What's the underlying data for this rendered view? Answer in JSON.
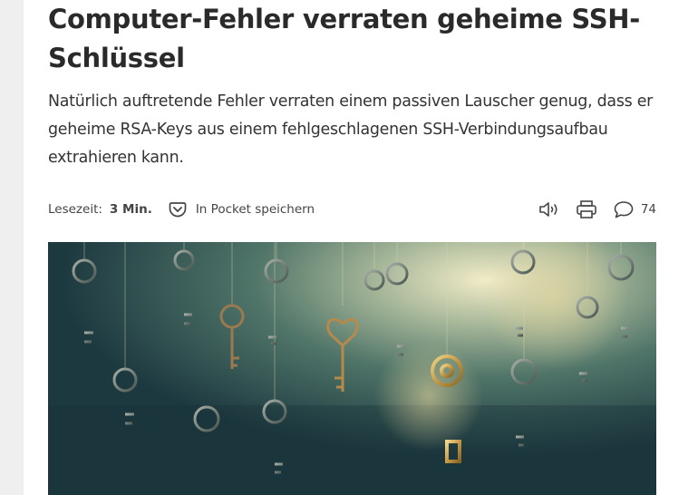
{
  "article": {
    "title": "Computer-Fehler verraten geheime SSH-Schlüssel",
    "title_line1": "Computer-Fehler verraten geheime SSH-",
    "title_line2": "Schlüssel",
    "lead_line1": "Natürlich auftretende Fehler verraten einem passiven Lauscher genug, dass er",
    "lead_line2": "geheime RSA-Keys aus einem fehlgeschlagenen SSH-Verbindungsaufbau",
    "lead_line3": "extrahieren kann."
  },
  "meta": {
    "reading_time_label": "Lesezeit:",
    "reading_time_value": "3 Min.",
    "pocket_label": "In Pocket speichern",
    "comment_count": "74"
  },
  "icons": {
    "pocket": "pocket-icon",
    "audio": "speaker-icon",
    "print": "printer-icon",
    "comments": "speech-bubble-icon"
  },
  "colors": {
    "title": "#2a2a2a",
    "text": "#333333",
    "meta": "#444444",
    "rail": "#efefef"
  }
}
